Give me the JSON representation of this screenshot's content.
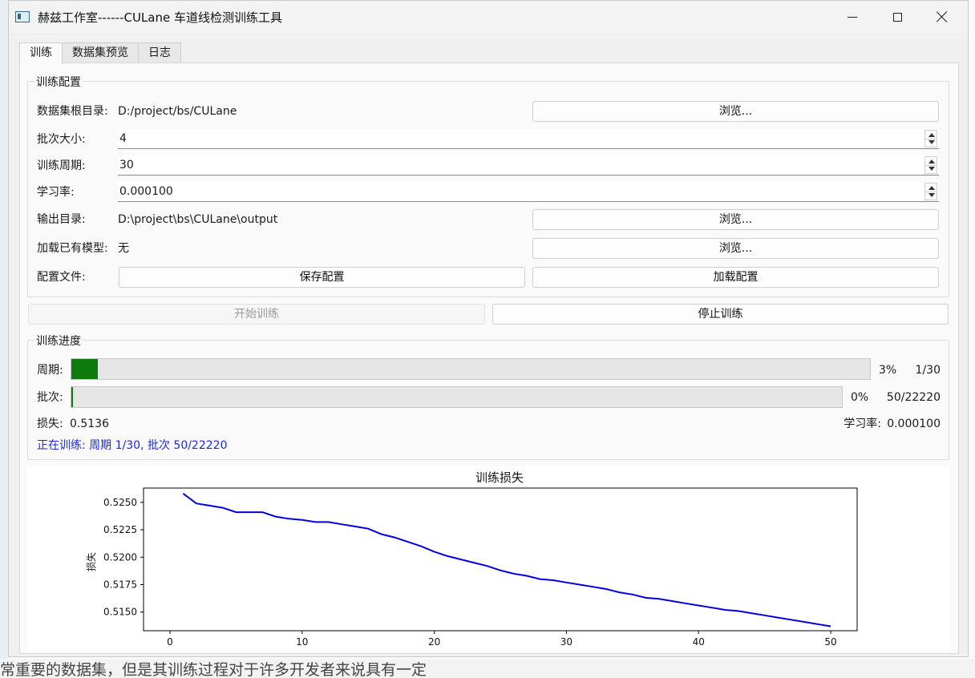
{
  "window": {
    "title": "赫兹工作室------CULane 车道线检测训练工具"
  },
  "tabs": [
    {
      "label": "训练",
      "active": true
    },
    {
      "label": "数据集预览",
      "active": false
    },
    {
      "label": "日志",
      "active": false
    }
  ],
  "config": {
    "group_title": "训练配置",
    "dataset_root_label": "数据集根目录:",
    "dataset_root_value": "D:/project/bs/CULane",
    "browse_label": "浏览...",
    "batch_size_label": "批次大小:",
    "batch_size_value": "4",
    "epochs_label": "训练周期:",
    "epochs_value": "30",
    "lr_label": "学习率:",
    "lr_value": "0.000100",
    "output_dir_label": "输出目录:",
    "output_dir_value": "D:\\project\\bs\\CULane\\output",
    "load_model_label": "加载已有模型:",
    "load_model_value": "无",
    "config_file_label": "配置文件:",
    "save_config_label": "保存配置",
    "load_config_label": "加载配置"
  },
  "actions": {
    "start_label": "开始训练",
    "stop_label": "停止训练"
  },
  "progress": {
    "group_title": "训练进度",
    "epoch_label": "周期:",
    "epoch_percent_text": "3%",
    "epoch_fraction": 0.0333,
    "epoch_count_text": "1/30",
    "batch_label": "批次:",
    "batch_percent_text": "0%",
    "batch_fraction": 0.00225,
    "batch_count_text": "50/22220",
    "loss_label": "损失:",
    "loss_value": "0.5136",
    "lr_label": "学习率:",
    "lr_value": "0.000100",
    "status_text": "正在训练: 周期 1/30, 批次 50/22220",
    "status_color": "#1d2bd6",
    "fill_color": "#0f7b0f"
  },
  "chart_data": {
    "type": "line",
    "title": "训练损失",
    "xlabel": "",
    "ylabel": "损失",
    "xlim": [
      -2,
      52
    ],
    "ylim": [
      0.5133,
      0.5263
    ],
    "xticks": [
      0,
      10,
      20,
      30,
      40,
      50
    ],
    "yticks": [
      0.515,
      0.5175,
      0.52,
      0.5225,
      0.525
    ],
    "ytick_labels": [
      "0.5150",
      "0.5175",
      "0.5200",
      "0.5225",
      "0.5250"
    ],
    "grid": false,
    "line_color": "#0000dd",
    "series": [
      {
        "x": [
          1,
          2,
          3,
          4,
          5,
          6,
          7,
          8,
          9,
          10,
          11,
          12,
          13,
          14,
          15,
          16,
          17,
          18,
          19,
          20,
          21,
          22,
          23,
          24,
          25,
          26,
          27,
          28,
          29,
          30,
          31,
          32,
          33,
          34,
          35,
          36,
          37,
          38,
          39,
          40,
          41,
          42,
          43,
          44,
          45,
          46,
          47,
          48,
          49,
          50
        ],
        "values": [
          0.5258,
          0.5249,
          0.5247,
          0.5245,
          0.5241,
          0.5241,
          0.5241,
          0.5237,
          0.5235,
          0.5234,
          0.5232,
          0.5232,
          0.523,
          0.5228,
          0.5226,
          0.5221,
          0.5218,
          0.5214,
          0.521,
          0.5205,
          0.5201,
          0.5198,
          0.5195,
          0.5192,
          0.5188,
          0.5185,
          0.5183,
          0.518,
          0.5179,
          0.5177,
          0.5175,
          0.5173,
          0.5171,
          0.5168,
          0.5166,
          0.5163,
          0.5162,
          0.516,
          0.5158,
          0.5156,
          0.5154,
          0.5152,
          0.5151,
          0.5149,
          0.5147,
          0.5145,
          0.5143,
          0.5141,
          0.5139,
          0.5137
        ]
      }
    ]
  },
  "background_text": "常重要的数据集，但是其训练过程对于许多开发者来说具有一定"
}
